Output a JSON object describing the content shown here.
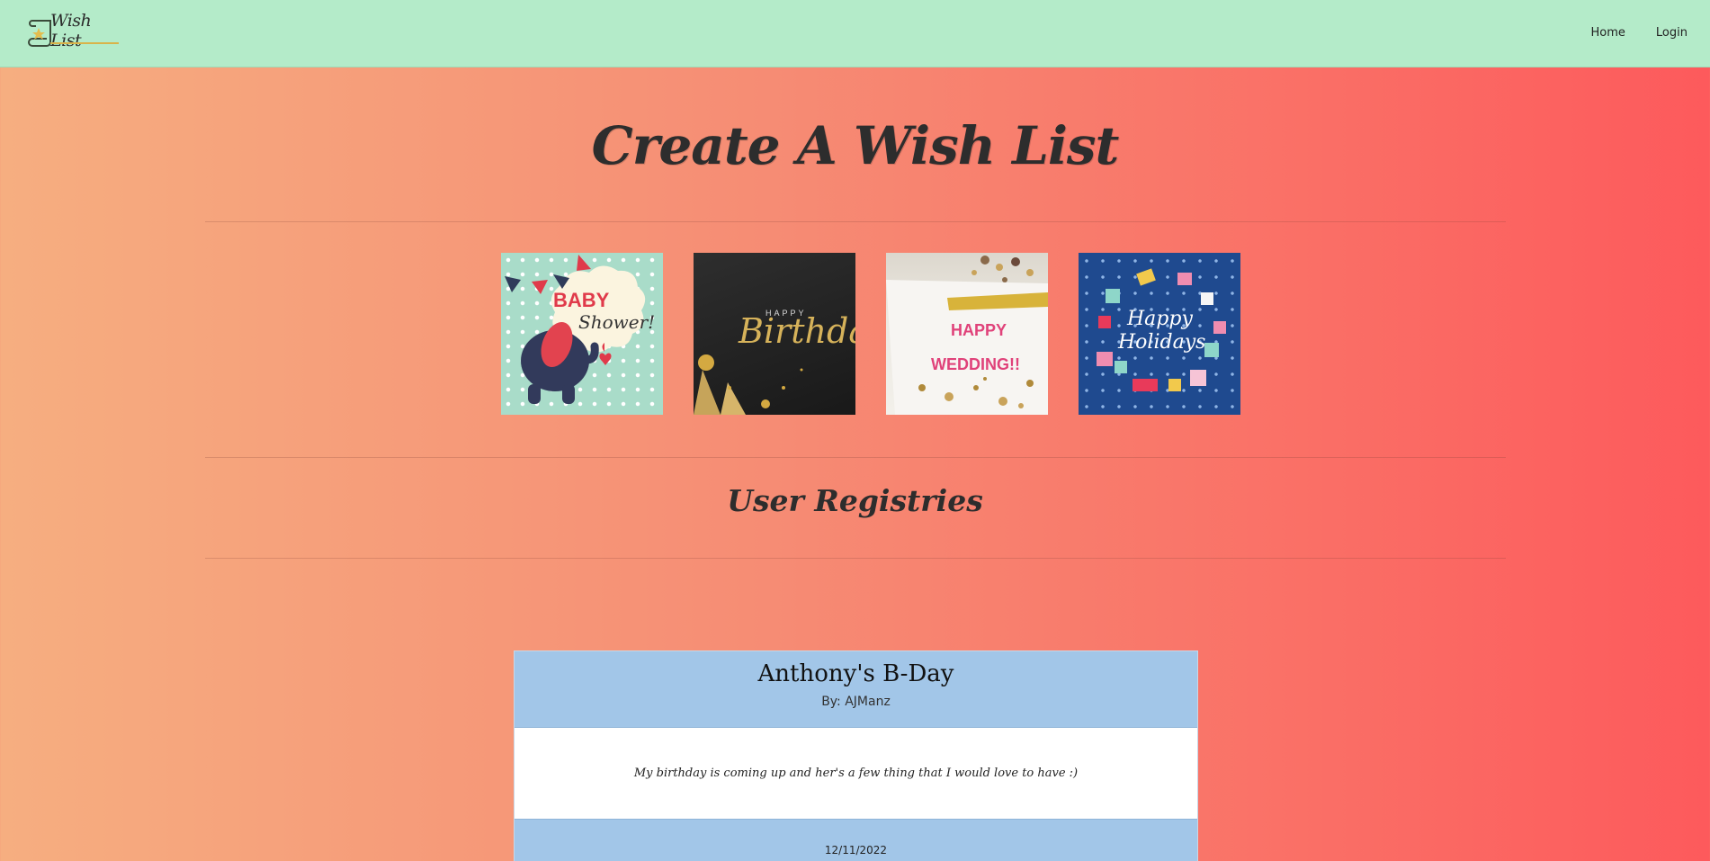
{
  "brand": {
    "name": "Wish List"
  },
  "nav": {
    "items": [
      {
        "label": "Home"
      },
      {
        "label": "Login"
      }
    ]
  },
  "main": {
    "title": "Create A Wish List",
    "cards": [
      {
        "name": "baby-shower",
        "text_line1": "BABY",
        "text_line2": "Shower!"
      },
      {
        "name": "birthday",
        "text_line1": "HAPPY",
        "text_line2": "Birthday"
      },
      {
        "name": "wedding",
        "text_line1": "HAPPY",
        "text_line2": "WEDDING!!"
      },
      {
        "name": "holidays",
        "text_line1": "Happy",
        "text_line2": "Holidays"
      }
    ],
    "registries_title": "User Registries"
  },
  "registries": [
    {
      "title": "Anthony's B-Day",
      "author": "By: AJManz",
      "description": "My birthday is coming up and her's a few thing that I would love to have :)",
      "date": "12/11/2022"
    }
  ],
  "colors": {
    "navbar": "#b4ebc9",
    "gradient_start": "#f6ae80",
    "gradient_end": "#fd5a5c",
    "registry_header": "#a2c6e8"
  }
}
